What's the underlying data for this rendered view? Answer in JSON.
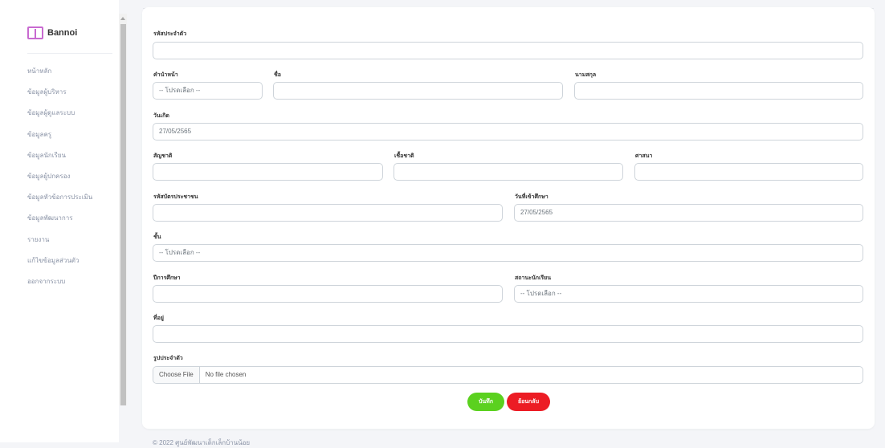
{
  "brand": {
    "name": "Bannoi",
    "icon": "book-icon"
  },
  "nav": [
    "หน้าหลัก",
    "ข้อมูลผู้บริหาร",
    "ข้อมูลผู้ดูแลระบบ",
    "ข้อมูลครู",
    "ข้อมูลนักเรียน",
    "ข้อมูลผู้ปกครอง",
    "ข้อมูลหัวข้อการประเมิน",
    "ข้อมูลพัฒนาการ",
    "รายงาน",
    "แก้ไขข้อมูลส่วนตัว",
    "ออกจากระบบ"
  ],
  "form": {
    "student_id": {
      "label": "รหัสประจำตัว",
      "value": ""
    },
    "prefix": {
      "label": "คำนำหน้า",
      "value": "-- โปรดเลือก --"
    },
    "first_name": {
      "label": "ชื่อ",
      "value": ""
    },
    "last_name": {
      "label": "นามสกุล",
      "value": ""
    },
    "birth_date": {
      "label": "วันเกิด",
      "value": "27/05/2565"
    },
    "nationality": {
      "label": "สัญชาติ",
      "value": ""
    },
    "ethnicity": {
      "label": "เชื้อชาติ",
      "value": ""
    },
    "religion": {
      "label": "ศาสนา",
      "value": ""
    },
    "citizen_id": {
      "label": "รหัสบัตรประชาชน",
      "value": ""
    },
    "enroll_date": {
      "label": "วันที่เข้าศึกษา",
      "value": "27/05/2565"
    },
    "grade": {
      "label": "ชั้น",
      "value": "-- โปรดเลือก --"
    },
    "academic_year": {
      "label": "ปีการศึกษา",
      "value": ""
    },
    "student_status": {
      "label": "สถานะนักเรียน",
      "value": "-- โปรดเลือก --"
    },
    "address": {
      "label": "ที่อยู่",
      "value": ""
    },
    "photo": {
      "label": "รูปประจำตัว",
      "button": "Choose File",
      "status": "No file chosen"
    }
  },
  "buttons": {
    "save": "บันทึก",
    "cancel": "ย้อนกลับ"
  },
  "colors": {
    "save": "#5bd11f",
    "cancel": "#ec1c24",
    "brand_icon": "#c86ad0"
  },
  "footer": "© 2022 ศูนย์พัฒนาเด็กเล็กบ้านน้อย"
}
